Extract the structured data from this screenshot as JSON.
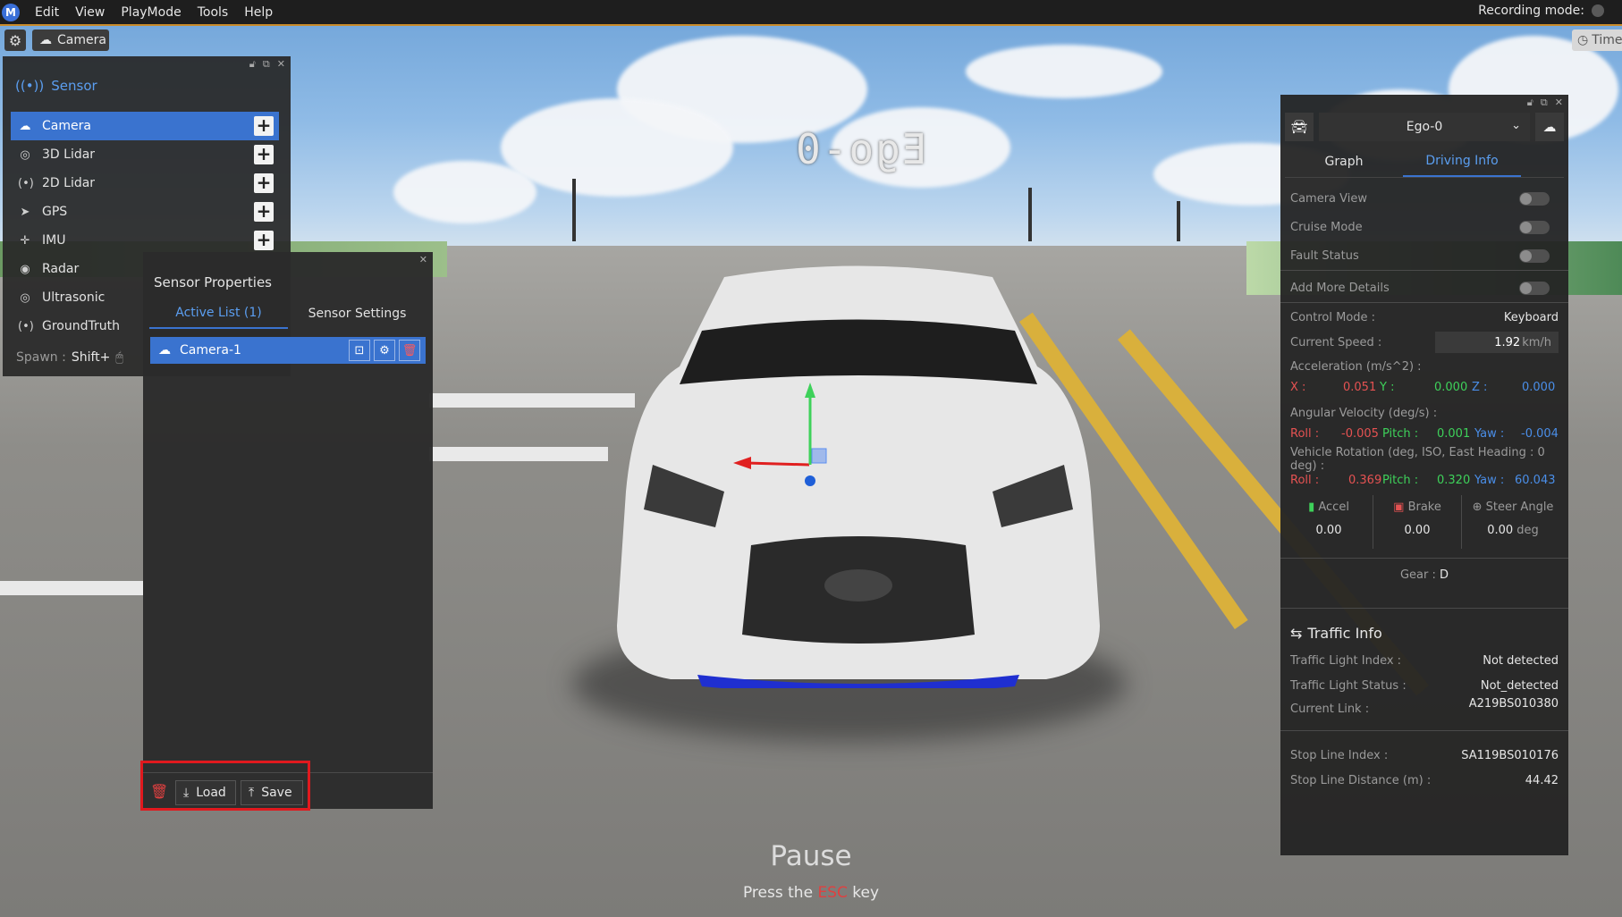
{
  "menubar": {
    "logo": "M",
    "items": [
      "Edit",
      "View",
      "PlayMode",
      "Tools",
      "Help"
    ],
    "recording_label": "Recording mode:"
  },
  "toolbar": {
    "camera_label": "Camera",
    "time_label": "Time"
  },
  "scene": {
    "vehicle_label": "Ego-0",
    "pause_title": "Pause",
    "pause_hint_before": "Press the ",
    "pause_hint_key": "ESC",
    "pause_hint_after": " key"
  },
  "sensor_panel": {
    "title": "Sensor",
    "items": [
      {
        "label": "Camera",
        "icon": "camera-icon",
        "active": true
      },
      {
        "label": "3D Lidar",
        "icon": "lidar-icon"
      },
      {
        "label": "2D Lidar",
        "icon": "lidar-2d-icon"
      },
      {
        "label": "GPS",
        "icon": "gps-icon"
      },
      {
        "label": "IMU",
        "icon": "imu-icon"
      },
      {
        "label": "Radar",
        "icon": "radar-icon"
      },
      {
        "label": "Ultrasonic",
        "icon": "ultrasonic-icon"
      },
      {
        "label": "GroundTruth",
        "icon": "groundtruth-icon"
      }
    ],
    "spawn_label": "Spawn :",
    "spawn_key": "Shift+"
  },
  "sensor_properties": {
    "title": "Sensor Properties",
    "tabs": [
      "Active List  (1)",
      "Sensor Settings"
    ],
    "active_item": "Camera-1",
    "load_label": "Load",
    "save_label": "Save"
  },
  "ego_panel": {
    "vehicle": "Ego-0",
    "tabs": [
      "Graph",
      "Driving Info"
    ],
    "toggles": [
      "Camera View",
      "Cruise Mode",
      "Fault Status",
      "Add More Details"
    ],
    "control_mode_label": "Control Mode :",
    "control_mode_value": "Keyboard",
    "speed_label": "Current Speed :",
    "speed_value": "1.92",
    "speed_unit": "km/h",
    "accel_label": "Acceleration (m/s^2) :",
    "accel": {
      "x_label": "X :",
      "x": "0.051",
      "y_label": "Y :",
      "y": "0.000",
      "z_label": "Z :",
      "z": "0.000"
    },
    "angvel_label": "Angular Velocity (deg/s) :",
    "angvel": {
      "roll_label": "Roll :",
      "roll": "-0.005",
      "pitch_label": "Pitch :",
      "pitch": "0.001",
      "yaw_label": "Yaw :",
      "yaw": "-0.004"
    },
    "rotation_label": "Vehicle Rotation (deg, ISO, East Heading : 0 deg) :",
    "rotation": {
      "roll_label": "Roll :",
      "roll": "0.369",
      "pitch_label": "Pitch :",
      "pitch": "0.320",
      "yaw_label": "Yaw :",
      "yaw": "60.043"
    },
    "accel_pedal_label": "Accel",
    "brake_label": "Brake",
    "steer_label": "Steer Angle",
    "accel_pedal": "0.00",
    "brake": "0.00",
    "steer": "0.00",
    "steer_unit": "deg",
    "gear_label": "Gear :",
    "gear": "D",
    "traffic_title": "Traffic Info",
    "traffic_light_index_label": "Traffic Light Index :",
    "traffic_light_index": "Not detected",
    "traffic_light_status_label": "Traffic Light Status :",
    "traffic_light_status": "Not_detected",
    "current_link_label": "Current Link :",
    "current_link": "A219BS010380",
    "stop_line_index_label": "Stop Line Index :",
    "stop_line_index": "SA119BS010176",
    "stop_line_distance_label": "Stop Line Distance (m) :",
    "stop_line_distance": "44.42"
  }
}
